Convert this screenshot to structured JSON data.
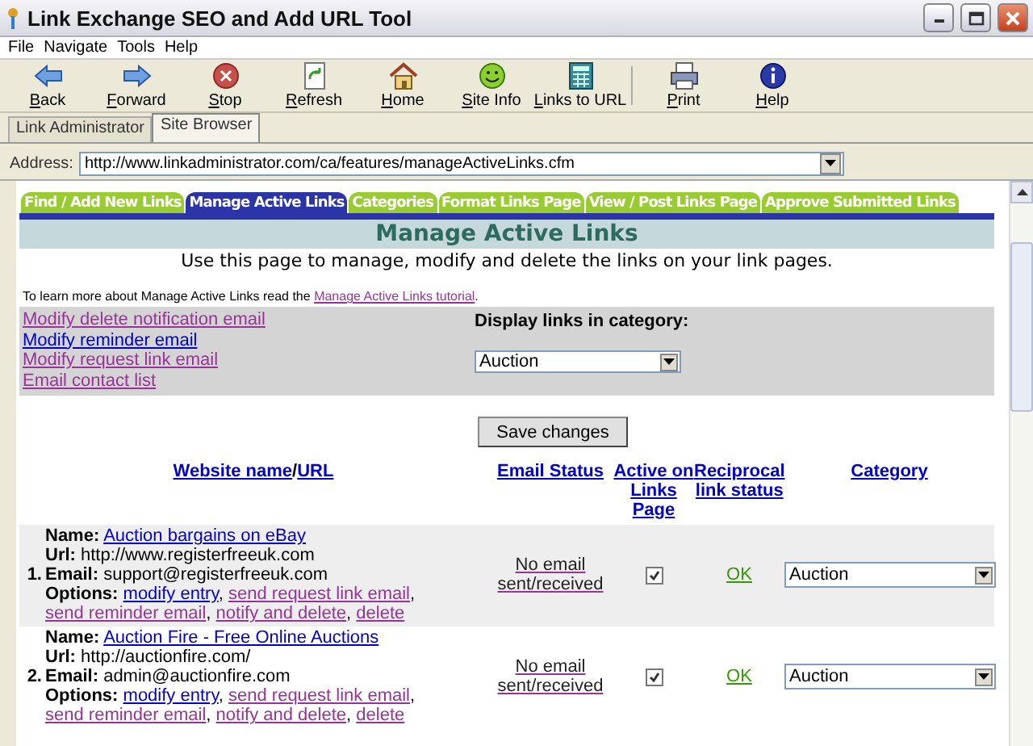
{
  "window": {
    "title": "Link Exchange SEO and Add URL Tool"
  },
  "menu": [
    "File",
    "Navigate",
    "Tools",
    "Help"
  ],
  "toolbar": [
    {
      "kind": "back",
      "label": "Back",
      "separated": false
    },
    {
      "kind": "forward",
      "label": "Forward",
      "separated": false
    },
    {
      "kind": "stop",
      "label": "Stop",
      "separated": false
    },
    {
      "kind": "refresh",
      "label": "Refresh",
      "separated": false
    },
    {
      "kind": "home",
      "label": "Home",
      "separated": false
    },
    {
      "kind": "siteinfo",
      "label": "Site Info",
      "separated": false
    },
    {
      "kind": "links",
      "label": "Links to URL",
      "separated": false
    },
    {
      "kind": "print",
      "label": "Print",
      "separated": true
    },
    {
      "kind": "help",
      "label": "Help",
      "separated": false
    }
  ],
  "app_tabs": [
    {
      "label": "Link Administrator",
      "selected": false
    },
    {
      "label": "Site Browser",
      "selected": true
    }
  ],
  "address": {
    "label": "Address:",
    "value": "http://www.linkadministrator.com/ca/features/manageActiveLinks.cfm"
  },
  "page": {
    "nav_tabs": [
      {
        "label": "Find / Add New Links",
        "selected": false
      },
      {
        "label": "Manage Active Links",
        "selected": true
      },
      {
        "label": "Categories",
        "selected": false
      },
      {
        "label": "Format Links Page",
        "selected": false
      },
      {
        "label": "View / Post Links Page",
        "selected": false
      },
      {
        "label": "Approve Submitted Links",
        "selected": false
      }
    ],
    "heading": "Manage Active Links",
    "intro": "Use this page to manage, modify and delete the links on your link pages.",
    "learn": {
      "text": "To learn more about Manage Active Links read the ",
      "link": "Manage Active Links tutorial",
      "end": "."
    },
    "side_links": [
      {
        "label": "Modify delete notification email",
        "visited": true
      },
      {
        "label": "Modify reminder email",
        "visited": false
      },
      {
        "label": "Modify request link email",
        "visited": true
      },
      {
        "label": "Email contact list",
        "visited": true
      }
    ],
    "category": {
      "label": "Display links in category:",
      "value": "Auction"
    },
    "save_button": "Save changes",
    "columns": [
      {
        "kind": "split",
        "links": [
          "Website name",
          "URL"
        ],
        "separator": "/"
      },
      {
        "kind": "link",
        "label": "Email Status"
      },
      {
        "kind": "link",
        "label": "Active on Links Page"
      },
      {
        "kind": "link",
        "label": "Reciprocal link status"
      },
      {
        "kind": "link",
        "label": "Category"
      }
    ],
    "rows": [
      {
        "number": "1.",
        "name_label": "Name:",
        "name": "Auction bargains on eBay",
        "url_label": "Url:",
        "url": "http://www.registerfreeuk.com",
        "email_label": "Email:",
        "email": "support@registerfreeuk.com",
        "options_label": "Options:",
        "options": [
          {
            "label": "modify entry",
            "visited": false
          },
          {
            "label": "send request link email",
            "visited": true
          },
          {
            "label": "send reminder email",
            "visited": true
          },
          {
            "label": "notify and delete",
            "visited": true
          },
          {
            "label": "delete",
            "visited": true
          }
        ],
        "separator": ",",
        "email_status": "No email sent/received",
        "active": true,
        "reciprocal": "OK",
        "category": "Auction",
        "shaded": true
      },
      {
        "number": "2.",
        "name_label": "Name:",
        "name": "Auction Fire - Free Online Auctions",
        "url_label": "Url:",
        "url": "http://auctionfire.com/",
        "email_label": "Email:",
        "email": "admin@auctionfire.com",
        "options_label": "Options:",
        "options": [
          {
            "label": "modify entry",
            "visited": false
          },
          {
            "label": "send request link email",
            "visited": true
          },
          {
            "label": "send reminder email",
            "visited": true
          },
          {
            "label": "notify and delete",
            "visited": true
          },
          {
            "label": "delete",
            "visited": true
          }
        ],
        "separator": ",",
        "email_status": "No email sent/received",
        "active": true,
        "reciprocal": "OK",
        "category": "Auction",
        "shaded": false
      }
    ]
  }
}
